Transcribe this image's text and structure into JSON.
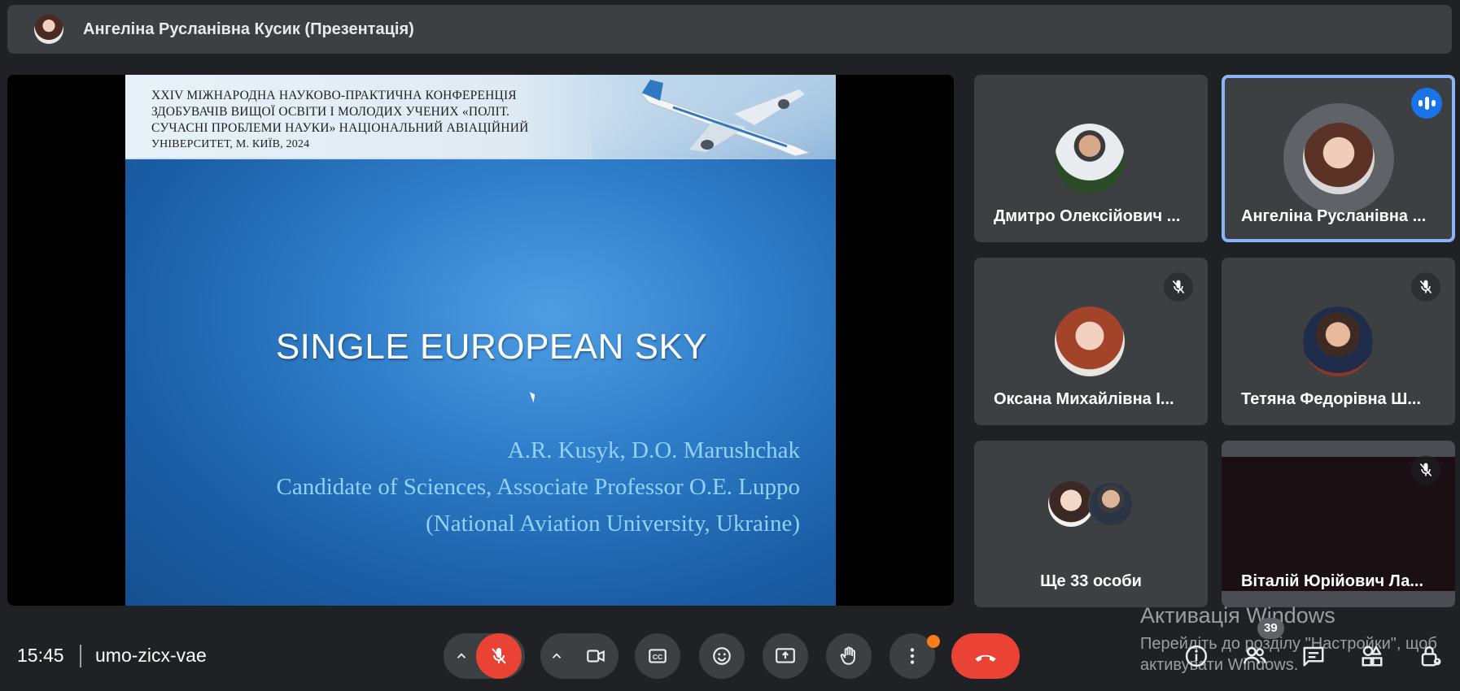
{
  "header": {
    "presenter_title": "Ангеліна Русланівна Кусик (Презентація)"
  },
  "slide": {
    "conference_lines": [
      "XXIV МІЖНАРОДНА НАУКОВО-ПРАКТИЧНА КОНФЕРЕНЦІЯ",
      "ЗДОБУВАЧІВ ВИЩОЇ ОСВІТИ І МОЛОДИХ УЧЕНИХ «ПОЛІТ.",
      "СУЧАСНІ ПРОБЛЕМИ НАУКИ» НАЦІОНАЛЬНИЙ АВІАЦІЙНИЙ",
      "УНІВЕРСИТЕТ, М. КИЇВ, 2024"
    ],
    "title": "SINGLE EUROPEAN SKY",
    "authors": "A.R. Kusyk, D.O. Marushchak",
    "supervisor": "Candidate of Sciences, Associate Professor O.E. Luppo",
    "affiliation": "(National Aviation University, Ukraine)"
  },
  "participants": [
    {
      "name": "Дмитро Олексійович ...",
      "muted": false
    },
    {
      "name": "Ангеліна Русланівна ...",
      "muted": false,
      "speaking": true
    },
    {
      "name": "Оксана Михайлівна І...",
      "muted": true
    },
    {
      "name": "Тетяна Федорівна Ш...",
      "muted": true
    },
    {
      "name": "Ще 33 особи"
    },
    {
      "name": "Віталій Юрійович Ла...",
      "muted": true
    }
  ],
  "footer": {
    "time": "15:45",
    "meeting_code": "umo-zicx-vae",
    "participant_count": "39"
  },
  "controls": [
    "chevron-up-icon",
    "mic-off-icon",
    "chevron-up-icon",
    "camera-icon",
    "captions-icon",
    "emoji-icon",
    "present-icon",
    "raise-hand-icon",
    "more-vert-icon",
    "end-call-icon"
  ],
  "right_controls": [
    "info-icon",
    "people-icon",
    "chat-icon",
    "activities-icon",
    "host-controls-icon"
  ],
  "windows_watermark": {
    "title": "Активація Windows",
    "line1": "Перейдіть до розділу \"Настройки\", щоб",
    "line2": "активувати Windows."
  },
  "colors": {
    "background": "#202124",
    "tile": "#3c4043",
    "end_call": "#ea4335",
    "mic_off": "#ea4335",
    "active_outline": "#8ab4f8",
    "speaking_badge": "#1a73e8",
    "notification_dot": "#fa7b17"
  }
}
